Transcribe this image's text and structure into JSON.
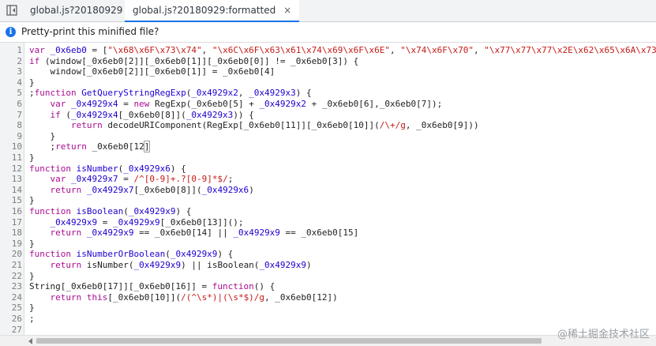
{
  "tabs": [
    {
      "label": "global.js?20180929",
      "active": false
    },
    {
      "label": "global.js?20180929:formatted",
      "active": true
    }
  ],
  "tab_close_glyph": "×",
  "infobar": {
    "icon": "i",
    "text": "Pretty-print this minified file?"
  },
  "editor": {
    "lines": [
      {
        "n": "1",
        "tokens": [
          [
            "keyword",
            "var"
          ],
          [
            "plain",
            " "
          ],
          [
            "def",
            "_0x6eb0"
          ],
          [
            "plain",
            " = ["
          ],
          [
            "string",
            "\"\\x68\\x6F\\x73\\x74\""
          ],
          [
            "plain",
            ", "
          ],
          [
            "string",
            "\"\\x6C\\x6F\\x63\\x61\\x74\\x69\\x6F\\x6E\""
          ],
          [
            "plain",
            ", "
          ],
          [
            "string",
            "\"\\x74\\x6F\\x70\""
          ],
          [
            "plain",
            ", "
          ],
          [
            "string",
            "\"\\x77\\x77\\x77\\x2E\\x62\\x65\\x6A\\x73"
          ]
        ]
      },
      {
        "n": "2",
        "tokens": [
          [
            "keyword",
            "if"
          ],
          [
            "plain",
            " (window[_0x6eb0[2]][_0x6eb0[1]][_0x6eb0[0]] != _0x6eb0[3]) {"
          ]
        ]
      },
      {
        "n": "3",
        "tokens": [
          [
            "plain",
            "    window[_0x6eb0[2]][_0x6eb0[1]] = _0x6eb0[4]"
          ]
        ]
      },
      {
        "n": "4",
        "tokens": [
          [
            "plain",
            "}"
          ]
        ]
      },
      {
        "n": "5",
        "tokens": [
          [
            "plain",
            ";"
          ],
          [
            "keyword",
            "function"
          ],
          [
            "plain",
            " "
          ],
          [
            "def",
            "GetQueryStringRegExp"
          ],
          [
            "plain",
            "("
          ],
          [
            "def",
            "_0x4929x2"
          ],
          [
            "plain",
            ", "
          ],
          [
            "def",
            "_0x4929x3"
          ],
          [
            "plain",
            ") {"
          ]
        ]
      },
      {
        "n": "6",
        "tokens": [
          [
            "plain",
            "    "
          ],
          [
            "keyword",
            "var"
          ],
          [
            "plain",
            " "
          ],
          [
            "def",
            "_0x4929x4"
          ],
          [
            "plain",
            " = "
          ],
          [
            "keyword",
            "new"
          ],
          [
            "plain",
            " RegExp(_0x6eb0[5] + "
          ],
          [
            "variable",
            "_0x4929x2"
          ],
          [
            "plain",
            " + _0x6eb0[6],_0x6eb0[7]);"
          ]
        ]
      },
      {
        "n": "7",
        "tokens": [
          [
            "plain",
            "    "
          ],
          [
            "keyword",
            "if"
          ],
          [
            "plain",
            " ("
          ],
          [
            "variable",
            "_0x4929x4"
          ],
          [
            "plain",
            "[_0x6eb0[8]]("
          ],
          [
            "variable",
            "_0x4929x3"
          ],
          [
            "plain",
            ")) {"
          ]
        ]
      },
      {
        "n": "8",
        "tokens": [
          [
            "plain",
            "        "
          ],
          [
            "keyword",
            "return"
          ],
          [
            "plain",
            " decodeURIComponent(RegExp[_0x6eb0[11]][_0x6eb0[10]]("
          ],
          [
            "regex",
            "/\\+/g"
          ],
          [
            "plain",
            ", _0x6eb0[9]))"
          ]
        ]
      },
      {
        "n": "9",
        "tokens": [
          [
            "plain",
            "    }"
          ]
        ]
      },
      {
        "n": "10",
        "tokens": [
          [
            "plain",
            "    ;"
          ],
          [
            "keyword",
            "return"
          ],
          [
            "plain",
            " _0x6eb0[12"
          ],
          [
            "bracket",
            "]"
          ]
        ]
      },
      {
        "n": "11",
        "tokens": [
          [
            "plain",
            "}"
          ]
        ]
      },
      {
        "n": "12",
        "tokens": [
          [
            "keyword",
            "function"
          ],
          [
            "plain",
            " "
          ],
          [
            "def",
            "isNumber"
          ],
          [
            "plain",
            "("
          ],
          [
            "def",
            "_0x4929x6"
          ],
          [
            "plain",
            ") {"
          ]
        ]
      },
      {
        "n": "13",
        "tokens": [
          [
            "plain",
            "    "
          ],
          [
            "keyword",
            "var"
          ],
          [
            "plain",
            " "
          ],
          [
            "def",
            "_0x4929x7"
          ],
          [
            "plain",
            " = "
          ],
          [
            "regex",
            "/^[0-9]+.?[0-9]*$/"
          ],
          [
            "plain",
            ";"
          ]
        ]
      },
      {
        "n": "14",
        "tokens": [
          [
            "plain",
            "    "
          ],
          [
            "keyword",
            "return"
          ],
          [
            "plain",
            " "
          ],
          [
            "variable",
            "_0x4929x7"
          ],
          [
            "plain",
            "[_0x6eb0[8]]("
          ],
          [
            "variable",
            "_0x4929x6"
          ],
          [
            "plain",
            ")"
          ]
        ]
      },
      {
        "n": "15",
        "tokens": [
          [
            "plain",
            "}"
          ]
        ]
      },
      {
        "n": "16",
        "tokens": [
          [
            "keyword",
            "function"
          ],
          [
            "plain",
            " "
          ],
          [
            "def",
            "isBoolean"
          ],
          [
            "plain",
            "("
          ],
          [
            "def",
            "_0x4929x9"
          ],
          [
            "plain",
            ") {"
          ]
        ]
      },
      {
        "n": "17",
        "tokens": [
          [
            "plain",
            "    "
          ],
          [
            "variable",
            "_0x4929x9"
          ],
          [
            "plain",
            " = "
          ],
          [
            "variable",
            "_0x4929x9"
          ],
          [
            "plain",
            "[_0x6eb0[13]]();"
          ]
        ]
      },
      {
        "n": "18",
        "tokens": [
          [
            "plain",
            "    "
          ],
          [
            "keyword",
            "return"
          ],
          [
            "plain",
            " "
          ],
          [
            "variable",
            "_0x4929x9"
          ],
          [
            "plain",
            " == _0x6eb0[14] || "
          ],
          [
            "variable",
            "_0x4929x9"
          ],
          [
            "plain",
            " == _0x6eb0[15]"
          ]
        ]
      },
      {
        "n": "19",
        "tokens": [
          [
            "plain",
            "}"
          ]
        ]
      },
      {
        "n": "20",
        "tokens": [
          [
            "keyword",
            "function"
          ],
          [
            "plain",
            " "
          ],
          [
            "def",
            "isNumberOrBoolean"
          ],
          [
            "plain",
            "("
          ],
          [
            "def",
            "_0x4929x9"
          ],
          [
            "plain",
            ") {"
          ]
        ]
      },
      {
        "n": "21",
        "tokens": [
          [
            "plain",
            "    "
          ],
          [
            "keyword",
            "return"
          ],
          [
            "plain",
            " isNumber("
          ],
          [
            "variable",
            "_0x4929x9"
          ],
          [
            "plain",
            ") || isBoolean("
          ],
          [
            "variable",
            "_0x4929x9"
          ],
          [
            "plain",
            ")"
          ]
        ]
      },
      {
        "n": "22",
        "tokens": [
          [
            "plain",
            "}"
          ]
        ]
      },
      {
        "n": "23",
        "tokens": [
          [
            "plain",
            "String[_0x6eb0[17]][_0x6eb0[16]] = "
          ],
          [
            "keyword",
            "function"
          ],
          [
            "plain",
            "() {"
          ]
        ]
      },
      {
        "n": "24",
        "tokens": [
          [
            "plain",
            "    "
          ],
          [
            "keyword",
            "return"
          ],
          [
            "plain",
            " "
          ],
          [
            "keyword",
            "this"
          ],
          [
            "plain",
            "[_0x6eb0[10]]("
          ],
          [
            "regex",
            "/(^\\s*)|(\\s*$)/g"
          ],
          [
            "plain",
            ", _0x6eb0[12])"
          ]
        ]
      },
      {
        "n": "25",
        "tokens": [
          [
            "plain",
            "}"
          ]
        ]
      },
      {
        "n": "26",
        "tokens": [
          [
            "plain",
            ";"
          ]
        ]
      },
      {
        "n": "27",
        "tokens": [
          [
            "plain",
            ""
          ]
        ]
      }
    ]
  },
  "watermark": "@稀土掘金技术社区",
  "colors": {
    "keyword": "#aa0d91",
    "string": "#c41a16",
    "variable": "#1c00cf",
    "accent": "#1a73e8"
  }
}
